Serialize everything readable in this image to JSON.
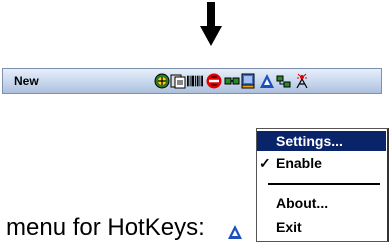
{
  "taskbar": {
    "new_label": "New",
    "tray_icons": [
      "bluetooth-icon",
      "sd-card-icon",
      "barcode-icon",
      "no-connection-icon",
      "network-icon",
      "battery-charging-icon",
      "hotkeys-icon",
      "signal-icon",
      "antenna-icon"
    ]
  },
  "menu": {
    "items": [
      {
        "label": "Settings...",
        "selected": true
      },
      {
        "label": "Enable",
        "checked": true
      },
      {
        "label": "About..."
      },
      {
        "label": "Exit"
      }
    ]
  },
  "caption": {
    "text": "menu for HotKeys:"
  },
  "colors": {
    "menu_highlight": "#0a246a",
    "taskbar_top": "#e7eff9",
    "taskbar_bottom": "#aebfdc"
  }
}
